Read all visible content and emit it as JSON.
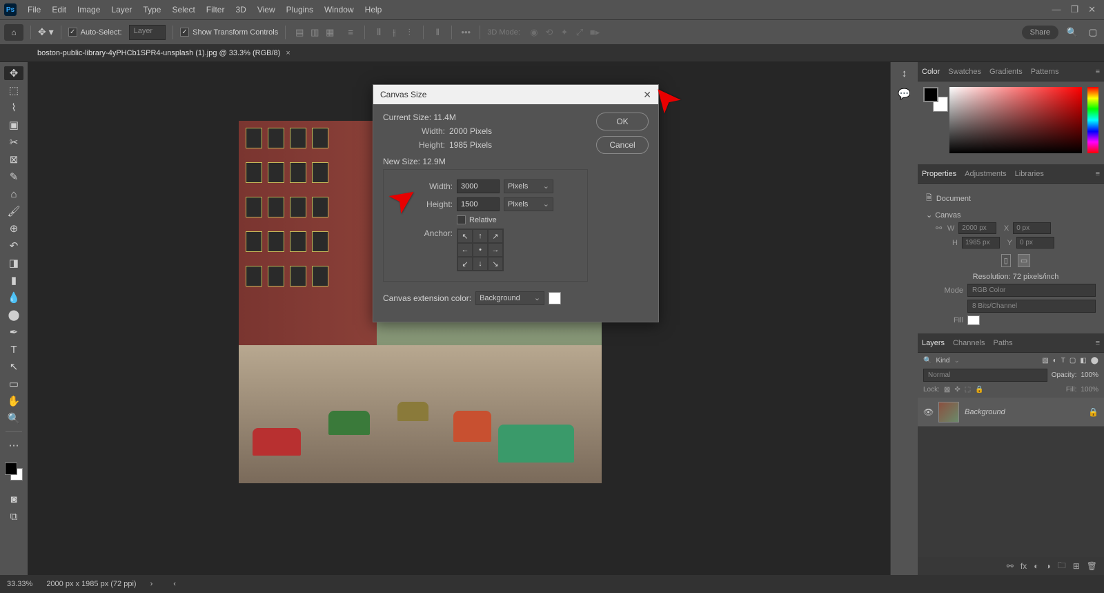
{
  "menubar": {
    "items": [
      "File",
      "Edit",
      "Image",
      "Layer",
      "Type",
      "Select",
      "Filter",
      "3D",
      "View",
      "Plugins",
      "Window",
      "Help"
    ]
  },
  "optbar": {
    "auto_select": "Auto-Select:",
    "auto_target": "Layer",
    "show_transform": "Show Transform Controls",
    "mode3d": "3D Mode:",
    "share": "Share"
  },
  "tab": {
    "title": "boston-public-library-4yPHCb1SPR4-unsplash (1).jpg @ 33.3% (RGB/8)"
  },
  "color_tabs": [
    "Color",
    "Swatches",
    "Gradients",
    "Patterns"
  ],
  "props_tabs": [
    "Properties",
    "Adjustments",
    "Libraries"
  ],
  "props": {
    "doc": "Document",
    "canvas": "Canvas",
    "w_lbl": "W",
    "w_val": "2000 px",
    "x_lbl": "X",
    "x_val": "0 px",
    "h_lbl": "H",
    "h_val": "1985 px",
    "y_lbl": "Y",
    "y_val": "0 px",
    "res": "Resolution: 72 pixels/inch",
    "mode_lbl": "Mode",
    "mode_val": "RGB Color",
    "bits": "8 Bits/Channel",
    "fill": "Fill"
  },
  "layers_tabs": [
    "Layers",
    "Channels",
    "Paths"
  ],
  "layers": {
    "kind": "Kind",
    "normal": "Normal",
    "opacity_lbl": "Opacity:",
    "opacity_val": "100%",
    "lock": "Lock:",
    "fill_lbl": "Fill:",
    "fill_val": "100%",
    "layer_name": "Background"
  },
  "status": {
    "zoom": "33.33%",
    "dims": "2000 px x 1985 px (72 ppi)"
  },
  "dialog": {
    "title": "Canvas Size",
    "ok": "OK",
    "cancel": "Cancel",
    "current": "Current Size: 11.4M",
    "cur_w_lbl": "Width:",
    "cur_w": "2000 Pixels",
    "cur_h_lbl": "Height:",
    "cur_h": "1985 Pixels",
    "new": "New Size: 12.9M",
    "new_w_lbl": "Width:",
    "new_w": "3000",
    "new_w_unit": "Pixels",
    "new_h_lbl": "Height:",
    "new_h": "1500",
    "new_h_unit": "Pixels",
    "relative": "Relative",
    "anchor": "Anchor:",
    "ext_lbl": "Canvas extension color:",
    "ext_val": "Background"
  }
}
